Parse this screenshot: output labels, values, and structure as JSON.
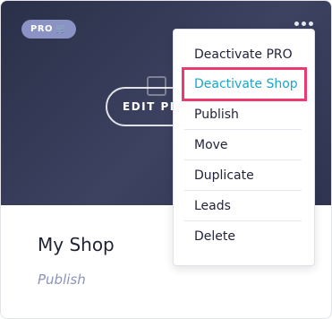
{
  "card": {
    "badge_label": "PRO",
    "badge_icon": "cart-icon",
    "edit_button_label": "EDIT PRO",
    "shop_name": "My Shop",
    "shop_status": "Publish"
  },
  "menu": {
    "items": [
      {
        "label": "Deactivate PRO"
      },
      {
        "label": "Deactivate Shop"
      },
      {
        "label": "Publish"
      },
      {
        "label": "Move"
      },
      {
        "label": "Duplicate"
      },
      {
        "label": "Leads"
      },
      {
        "label": "Delete"
      }
    ]
  },
  "colors": {
    "hero_bg": "#2b3049",
    "badge_bg": "#8a93c4",
    "highlight_text": "#1aa6cc",
    "highlight_outline": "#ec3a6e",
    "status_text": "#8c93b8"
  }
}
